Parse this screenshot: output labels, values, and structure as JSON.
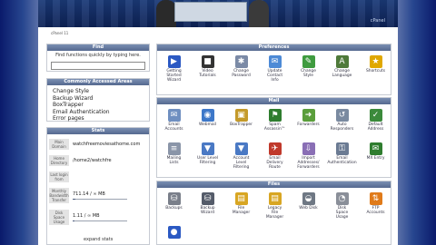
{
  "banner": {
    "brand": "cPanel"
  },
  "topnav": {
    "text": "cPanel 11"
  },
  "find": {
    "title": "Find",
    "hint": "Find functions quickly by typing here.",
    "placeholder": ""
  },
  "accessed": {
    "title": "Commonly Accessed Areas",
    "items": [
      "Change Style",
      "Backup Wizard",
      "BoxTrapper",
      "Email Authentication",
      "Error pages"
    ]
  },
  "stats": {
    "title": "Stats",
    "rows": [
      {
        "label": "Main Domain",
        "value": "watchfreemoviesathome.com"
      },
      {
        "label": "Home Directory",
        "value": "/home2/watchfre"
      },
      {
        "label": "Last login from",
        "value": ""
      },
      {
        "label": "Monthly Bandwidth Transfer",
        "value": "711.14 / ∞ MB"
      },
      {
        "label": "Disk Space Usage",
        "value": "1.11 / ∞ MB"
      }
    ],
    "expand_label": "expand stats"
  },
  "sections": [
    {
      "title": "Preferences",
      "tiles": [
        {
          "label": "Getting\nStarted\nWizard",
          "icon": "wizard-icon",
          "color": "#2b59c3",
          "glyph": "▶"
        },
        {
          "label": "Video\nTutorials",
          "icon": "video-icon",
          "color": "#333333",
          "glyph": "■"
        },
        {
          "label": "Change\nPassword",
          "icon": "password-icon",
          "color": "#7b8aa6",
          "glyph": "✱"
        },
        {
          "label": "Update\nContact\nInfo",
          "icon": "contact-icon",
          "color": "#4d8ad6",
          "glyph": "✉"
        },
        {
          "label": "Change\nStyle",
          "icon": "style-icon",
          "color": "#3f9b3f",
          "glyph": "✎"
        },
        {
          "label": "Change\nLanguage",
          "icon": "language-icon",
          "color": "#4f7a3a",
          "glyph": "A"
        },
        {
          "label": "Shortcuts",
          "icon": "star-icon",
          "color": "#e0a800",
          "glyph": "★"
        }
      ]
    },
    {
      "title": "Mail",
      "tiles": [
        {
          "label": "Email\nAccounts",
          "icon": "email-accounts-icon",
          "color": "#6f8fc0",
          "glyph": "✉"
        },
        {
          "label": "Webmail",
          "icon": "webmail-icon",
          "color": "#3d78c9",
          "glyph": "◉"
        },
        {
          "label": "BoxTrapper",
          "icon": "boxtrapper-icon",
          "color": "#c49a2a",
          "glyph": "▣"
        },
        {
          "label": "Spam\nAssassin™",
          "icon": "spam-icon",
          "color": "#2f7d2f",
          "glyph": "⚑"
        },
        {
          "label": "Forwarders",
          "icon": "forwarders-icon",
          "color": "#5a9e3b",
          "glyph": "➜"
        },
        {
          "label": "Auto\nResponders",
          "icon": "autoresponder-icon",
          "color": "#7a8aa0",
          "glyph": "↺"
        },
        {
          "label": "Default\nAddress",
          "icon": "default-address-icon",
          "color": "#3b8a3b",
          "glyph": "✓"
        },
        {
          "label": "Mailing\nLists",
          "icon": "mailing-lists-icon",
          "color": "#8a95a8",
          "glyph": "≡"
        },
        {
          "label": "User Level\nFiltering",
          "icon": "user-filter-icon",
          "color": "#4a79c4",
          "glyph": "▼"
        },
        {
          "label": "Account\nLevel\nFiltering",
          "icon": "account-filter-icon",
          "color": "#4a79c4",
          "glyph": "▼"
        },
        {
          "label": "Email\nDelivery\nRoute",
          "icon": "delivery-route-icon",
          "color": "#c0392b",
          "glyph": "✈"
        },
        {
          "label": "Import\nAddresses/\nForwarders",
          "icon": "import-icon",
          "color": "#8a6fb5",
          "glyph": "⇩"
        },
        {
          "label": "Email\nAuthentication",
          "icon": "email-auth-icon",
          "color": "#6b7b93",
          "glyph": "⚿"
        },
        {
          "label": "MX Entry",
          "icon": "mx-entry-icon",
          "color": "#2f7d2f",
          "glyph": "✉"
        }
      ]
    },
    {
      "title": "Files",
      "tiles": [
        {
          "label": "Backups",
          "icon": "backups-icon",
          "color": "#7a7f8a",
          "glyph": "⛁"
        },
        {
          "label": "Backup\nWizard",
          "icon": "backup-wizard-icon",
          "color": "#555c6a",
          "glyph": "⛁"
        },
        {
          "label": "File\nManager",
          "icon": "file-manager-icon",
          "color": "#d8a623",
          "glyph": "▤"
        },
        {
          "label": "Legacy\nFile\nManager",
          "icon": "legacy-file-manager-icon",
          "color": "#d8a623",
          "glyph": "▤"
        },
        {
          "label": "Web Disk",
          "icon": "web-disk-icon",
          "color": "#6f7884",
          "glyph": "◒"
        },
        {
          "label": "Disk\nSpace\nUsage",
          "icon": "disk-usage-icon",
          "color": "#8a8f99",
          "glyph": "◔"
        },
        {
          "label": "FTP\nAccounts",
          "icon": "ftp-icon",
          "color": "#e07b1a",
          "glyph": "⇅"
        },
        {
          "label": "",
          "icon": "ftp-session-icon",
          "color": "#2b59c3",
          "glyph": "●"
        }
      ]
    }
  ]
}
